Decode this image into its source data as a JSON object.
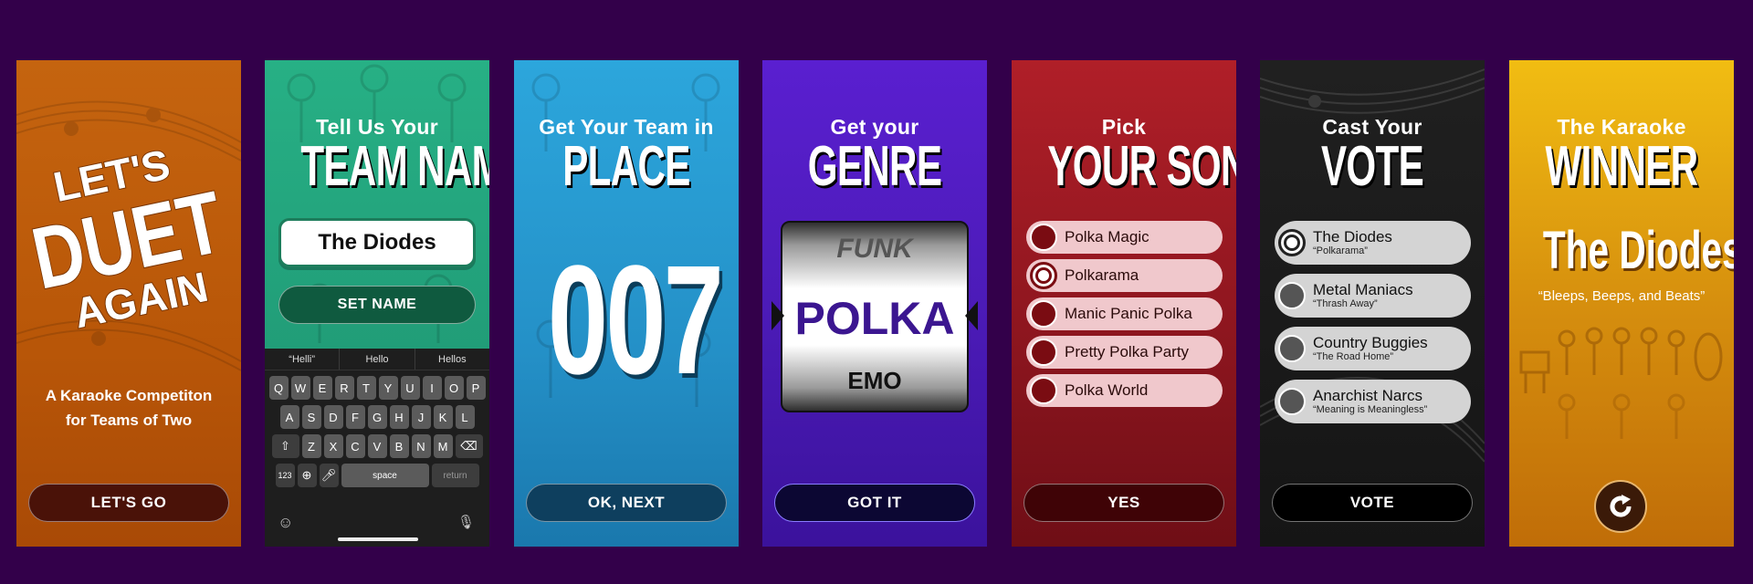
{
  "panel1": {
    "title_line1": "LET'S",
    "title_line2": "DUET",
    "title_line3": "AGAIN",
    "subtitle_line1": "A Karaoke Competiton",
    "subtitle_line2": "for Teams of Two",
    "button": "LET'S GO"
  },
  "panel2": {
    "heading_small": "Tell Us Your",
    "heading_big": "TEAM NAME",
    "team_input_value": "The Diodes",
    "button": "SET NAME",
    "suggestions": [
      "“Helli”",
      "Hello",
      "Hellos"
    ],
    "keys_row1": [
      "Q",
      "W",
      "E",
      "R",
      "T",
      "Y",
      "U",
      "I",
      "O",
      "P"
    ],
    "keys_row2": [
      "A",
      "S",
      "D",
      "F",
      "G",
      "H",
      "J",
      "K",
      "L"
    ],
    "keys_row3": [
      "Z",
      "X",
      "C",
      "V",
      "B",
      "N",
      "M"
    ],
    "key_123": "123",
    "key_space": "space",
    "key_return": "return"
  },
  "panel3": {
    "heading_small": "Get Your Team in",
    "heading_big": "PLACE",
    "number": "007",
    "button": "OK, NEXT"
  },
  "panel4": {
    "heading_small": "Get your",
    "heading_big": "GENRE",
    "genre_top": "FUNK",
    "genre_selected": "POLKA",
    "genre_bottom": "EMO",
    "button": "GOT IT"
  },
  "panel5": {
    "heading_small": "Pick",
    "heading_big": "YOUR SONG",
    "songs": [
      "Polka Magic",
      "Polkarama",
      "Manic Panic Polka",
      "Pretty Polka Party",
      "Polka World"
    ],
    "selected_index": 1,
    "button": "YES"
  },
  "panel6": {
    "heading_small": "Cast Your",
    "heading_big": "VOTE",
    "teams": [
      {
        "name": "The Diodes",
        "song": "“Polkarama”"
      },
      {
        "name": "Metal Maniacs",
        "song": "“Thrash Away”"
      },
      {
        "name": "Country Buggies",
        "song": "“The Road Home”"
      },
      {
        "name": "Anarchist Narcs",
        "song": "“Meaning is Meaningless”"
      }
    ],
    "selected_index": 0,
    "button": "VOTE"
  },
  "panel7": {
    "heading_small": "The Karaoke",
    "heading_big": "WINNER",
    "winner": "The Diodes",
    "winner_song": "“Bleeps, Beeps, and Beats”",
    "replay_icon": "refresh-icon"
  },
  "colors": {
    "background": "#33004a",
    "orange": "#c5640f",
    "green": "#27b085",
    "blue": "#2ca6dc",
    "purple": "#5a1fd0",
    "red": "#b01f28",
    "black": "#1b1b1b",
    "gold": "#f1bd12"
  }
}
